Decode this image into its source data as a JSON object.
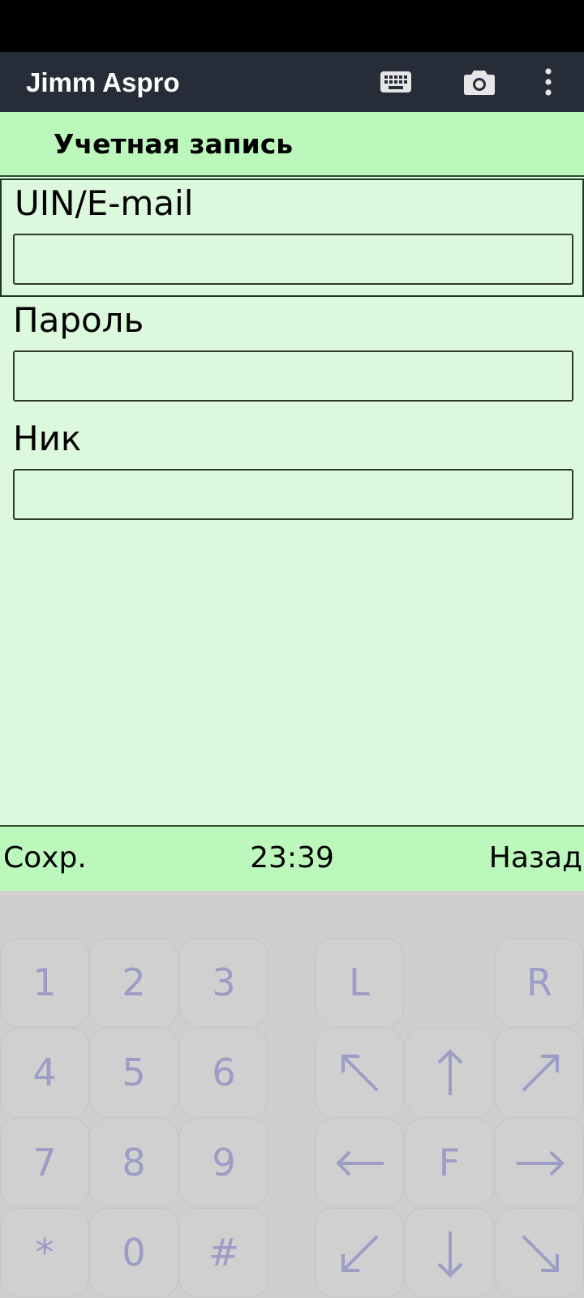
{
  "app_bar": {
    "title": "Jimm Aspro",
    "icons": [
      "keyboard-icon",
      "camera-icon",
      "more-vert-icon"
    ],
    "background": "#262d38"
  },
  "header": {
    "title": "Учетная запись"
  },
  "form": {
    "fields": [
      {
        "label": "UIN/E-mail",
        "value": "",
        "focused": true
      },
      {
        "label": "Пароль",
        "value": "",
        "focused": false
      },
      {
        "label": "Ник",
        "value": "",
        "focused": false
      }
    ]
  },
  "footer": {
    "left_softkey": "Сохр.",
    "clock": "23:39",
    "right_softkey": "Назад"
  },
  "keypad": {
    "numeric": [
      "1",
      "2",
      "3",
      "4",
      "5",
      "6",
      "7",
      "8",
      "9",
      "*",
      "0",
      "#"
    ],
    "nav": {
      "left": "L",
      "right": "R",
      "fire": "F",
      "arrows": [
        "up-left-arrow-icon",
        "up-arrow-icon",
        "up-right-arrow-icon",
        "left-arrow-icon",
        "right-arrow-icon",
        "down-left-arrow-icon",
        "down-arrow-icon",
        "down-right-arrow-icon"
      ]
    }
  },
  "colors": {
    "panel_bright": "#bcf8bc",
    "panel_light": "#ddf9dd",
    "key_glyph": "#9c9cc6",
    "keypad_bg": "#cfcfcf"
  }
}
